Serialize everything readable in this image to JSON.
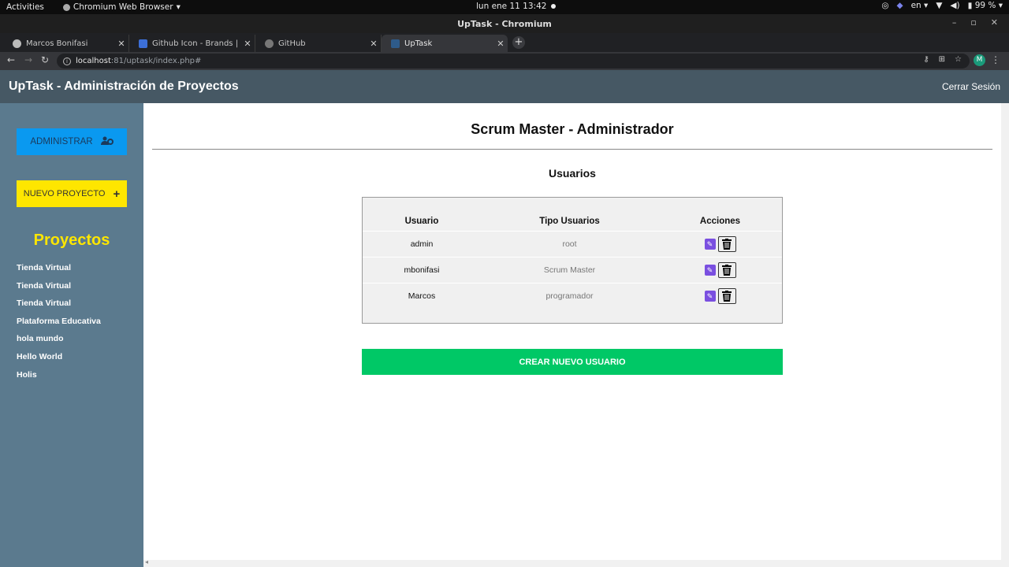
{
  "system_bar": {
    "activities": "Activities",
    "app_name": "Chromium Web Browser",
    "clock": "lun ene 11  13:42",
    "language": "en",
    "battery": "99 %"
  },
  "window": {
    "title": "UpTask - Chromium"
  },
  "tabs": [
    {
      "label": "Marcos Bonifasi",
      "icon": "globe-icon"
    },
    {
      "label": "Github Icon - Brands | Font",
      "icon": "flag-icon"
    },
    {
      "label": "GitHub",
      "icon": "github-icon"
    },
    {
      "label": "UpTask",
      "icon": "uptask-icon"
    }
  ],
  "address_bar": {
    "host": "localhost",
    "path": ":81/uptask/index.php#"
  },
  "profile_initial": "M",
  "header": {
    "title": "UpTask - Administración de Proyectos",
    "logout": "Cerrar Sesión"
  },
  "sidebar": {
    "admin_button": "ADMINISTRAR",
    "new_project_button": "NUEVO PROYECTO",
    "projects_title": "Proyectos",
    "projects": [
      "Tienda Virtual",
      "Tienda Virtual",
      "Tienda Virtual",
      "Plataforma Educativa",
      "hola mundo",
      "Hello World",
      "Holis"
    ]
  },
  "main": {
    "title": "Scrum Master - Administrador",
    "section_title": "Usuarios",
    "columns": [
      "Usuario",
      "Tipo Usuarios",
      "Acciones"
    ],
    "users": [
      {
        "name": "admin",
        "type": "root"
      },
      {
        "name": "mbonifasi",
        "type": "Scrum Master"
      },
      {
        "name": "Marcos",
        "type": "programador"
      }
    ],
    "create_button": "CREAR NUEVO USUARIO"
  },
  "colors": {
    "header_bg": "#465864",
    "sidebar_bg": "#5b7a8e",
    "admin_button": "#0a99f0",
    "new_project_button": "#fee600",
    "create_button": "#00c866",
    "edit_icon": "#7a4fe0"
  }
}
